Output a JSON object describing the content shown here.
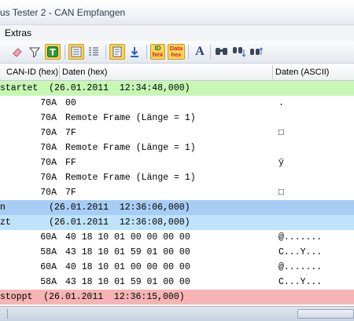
{
  "window": {
    "title": "us Tester 2 - CAN Empfangen"
  },
  "menu": {
    "extras": "Extras"
  },
  "toolbar": {
    "buttons": [
      {
        "icon": "eraser-icon",
        "active": false
      },
      {
        "icon": "filter-icon",
        "active": false
      },
      {
        "icon": "trigger-icon",
        "active": true
      },
      {
        "icon": "list-view-icon",
        "active": true
      },
      {
        "icon": "list-compact-icon",
        "active": false
      },
      {
        "icon": "save-log-icon",
        "active": true
      },
      {
        "icon": "download-icon",
        "active": false
      },
      {
        "icon": "id-hex-icon",
        "active": true,
        "label_top": "ID",
        "label_bottom": "hex"
      },
      {
        "icon": "data-hex-icon",
        "active": false,
        "label_top": "Data",
        "label_bottom": "hex"
      },
      {
        "icon": "font-icon",
        "active": false
      },
      {
        "icon": "find-icon",
        "active": false
      },
      {
        "icon": "find-down-icon",
        "active": false
      },
      {
        "icon": "find-up-icon",
        "active": false
      }
    ],
    "id_hex": {
      "top": "ID",
      "bottom": "hex"
    },
    "data_hex": {
      "top": "Data",
      "bottom": "hex"
    },
    "font_glyph": "A"
  },
  "columns": {
    "can_id": "CAN-ID (hex)",
    "data_hex": "Daten (hex)",
    "data_ascii": "Daten (ASCII)"
  },
  "rows": [
    {
      "type": "event",
      "state": "green",
      "text": "startet  (26.01.2011  12:34:48,000)"
    },
    {
      "type": "msg",
      "id": "70A",
      "data": "00",
      "ascii": "."
    },
    {
      "type": "msg",
      "id": "70A",
      "data": "Remote Frame (Länge = 1)",
      "ascii": ""
    },
    {
      "type": "msg",
      "id": "70A",
      "data": "7F",
      "ascii": "□"
    },
    {
      "type": "msg",
      "id": "70A",
      "data": "Remote Frame (Länge = 1)",
      "ascii": ""
    },
    {
      "type": "msg",
      "id": "70A",
      "data": "FF",
      "ascii": "ÿ"
    },
    {
      "type": "msg",
      "id": "70A",
      "data": "Remote Frame (Länge = 1)",
      "ascii": ""
    },
    {
      "type": "msg",
      "id": "70A",
      "data": "7F",
      "ascii": "□"
    },
    {
      "type": "event",
      "state": "blue",
      "text": "n        (26.01.2011  12:36:06,000)"
    },
    {
      "type": "event",
      "state": "lblue",
      "text": "zt       (26.01.2011  12:36:08,000)"
    },
    {
      "type": "msg",
      "id": "60A",
      "data": "40 18 10 01 00 00 00 00",
      "ascii": "@......."
    },
    {
      "type": "msg",
      "id": "58A",
      "data": "43 18 10 01 59 01 00 00",
      "ascii": "C...Y..."
    },
    {
      "type": "msg",
      "id": "60A",
      "data": "40 18 10 01 00 00 00 00",
      "ascii": "@......."
    },
    {
      "type": "msg",
      "id": "58A",
      "data": "43 18 10 01 59 01 00 00",
      "ascii": "C...Y..."
    },
    {
      "type": "event",
      "state": "red",
      "text": "stoppt  (26.01.2011  12:36:15,000)"
    }
  ],
  "colors": {
    "started": "#c6f7b4",
    "paused": "#a8cdf4",
    "resumed": "#bfe3fb",
    "stopped": "#f6b4b4",
    "toolbar_active": "#ffd35c"
  }
}
